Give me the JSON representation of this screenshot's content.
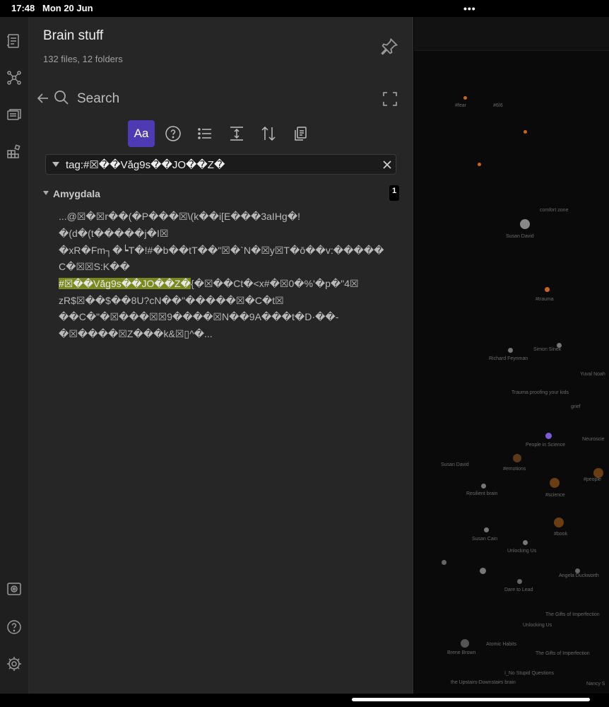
{
  "status": {
    "time": "17:48",
    "date": "Mon 20 Jun",
    "dots": "•••"
  },
  "ribbon": {
    "top_icons": [
      "file-explorer-icon",
      "graph-view-icon",
      "open-notes-icon",
      "plugin-grid-icon"
    ],
    "bottom_icons": [
      "vault-icon",
      "help-icon",
      "settings-icon"
    ]
  },
  "vault": {
    "title": "Brain stuff",
    "stats": "132 files, 12 folders"
  },
  "search": {
    "label": "Search",
    "query": "tag:#☒��Vá̆g9s��JO��Z�",
    "match_case_label": "Aa"
  },
  "toolbar": [
    "match-case-button",
    "explain-query-button",
    "collapse-results-button",
    "show-context-button",
    "sort-button",
    "copy-results-button"
  ],
  "result": {
    "title": "Amygdala",
    "count": "1",
    "lines": [
      {
        "text": "...@☒�☒r��(�P���☒\\(k��i[E���3aIHg�!"
      },
      {
        "text": "�(d�(t�����j�I☒"
      },
      {
        "text": "�xR�Fm┐�┕T�!#�b��tT��\"☒�`N�☒y☒T�ō��v:�����"
      },
      {
        "text": "C�☒☒S:K��"
      },
      {
        "highlight": "#☒��Vá̆g9s��JO��Z�",
        "text": "{�☒��Ct�<x#�☒0�%'�p�\"4☒"
      },
      {
        "text": "zR$☒��$��8U?cN��\"�����☒�C�t☒"
      },
      {
        "text": "��C�\"�☒���☒☒9����☒N��9A���t�D·��-"
      },
      {
        "text": "�☒����☒Z���k&☒▯^�..."
      }
    ]
  },
  "graph": {
    "labels": [
      "comfort zone",
      "Susan David",
      "#trauma",
      "Simon Sinek",
      "Richard Feynman",
      "Trauma proofing your kids",
      "Yuval Noah",
      "grief",
      "People in Science",
      "Neuroscie",
      "Susan David",
      "#emotions",
      "#people",
      "Resilient brain",
      "#science",
      "#book",
      "Susan Cain",
      "Unlocking Us",
      "Angela Duckworth",
      "Dare to Lead",
      "The Gifts of Imperfection",
      "Unlocking Us",
      "Atomic Habits",
      "Brene Brown",
      "The Gifts of Imperfection",
      "I_No Stupid Questions",
      "the Upstairs-Downstairs brain",
      "Nancy S",
      "#fear",
      "#6İ6"
    ],
    "accent": "#7c5cd6"
  }
}
